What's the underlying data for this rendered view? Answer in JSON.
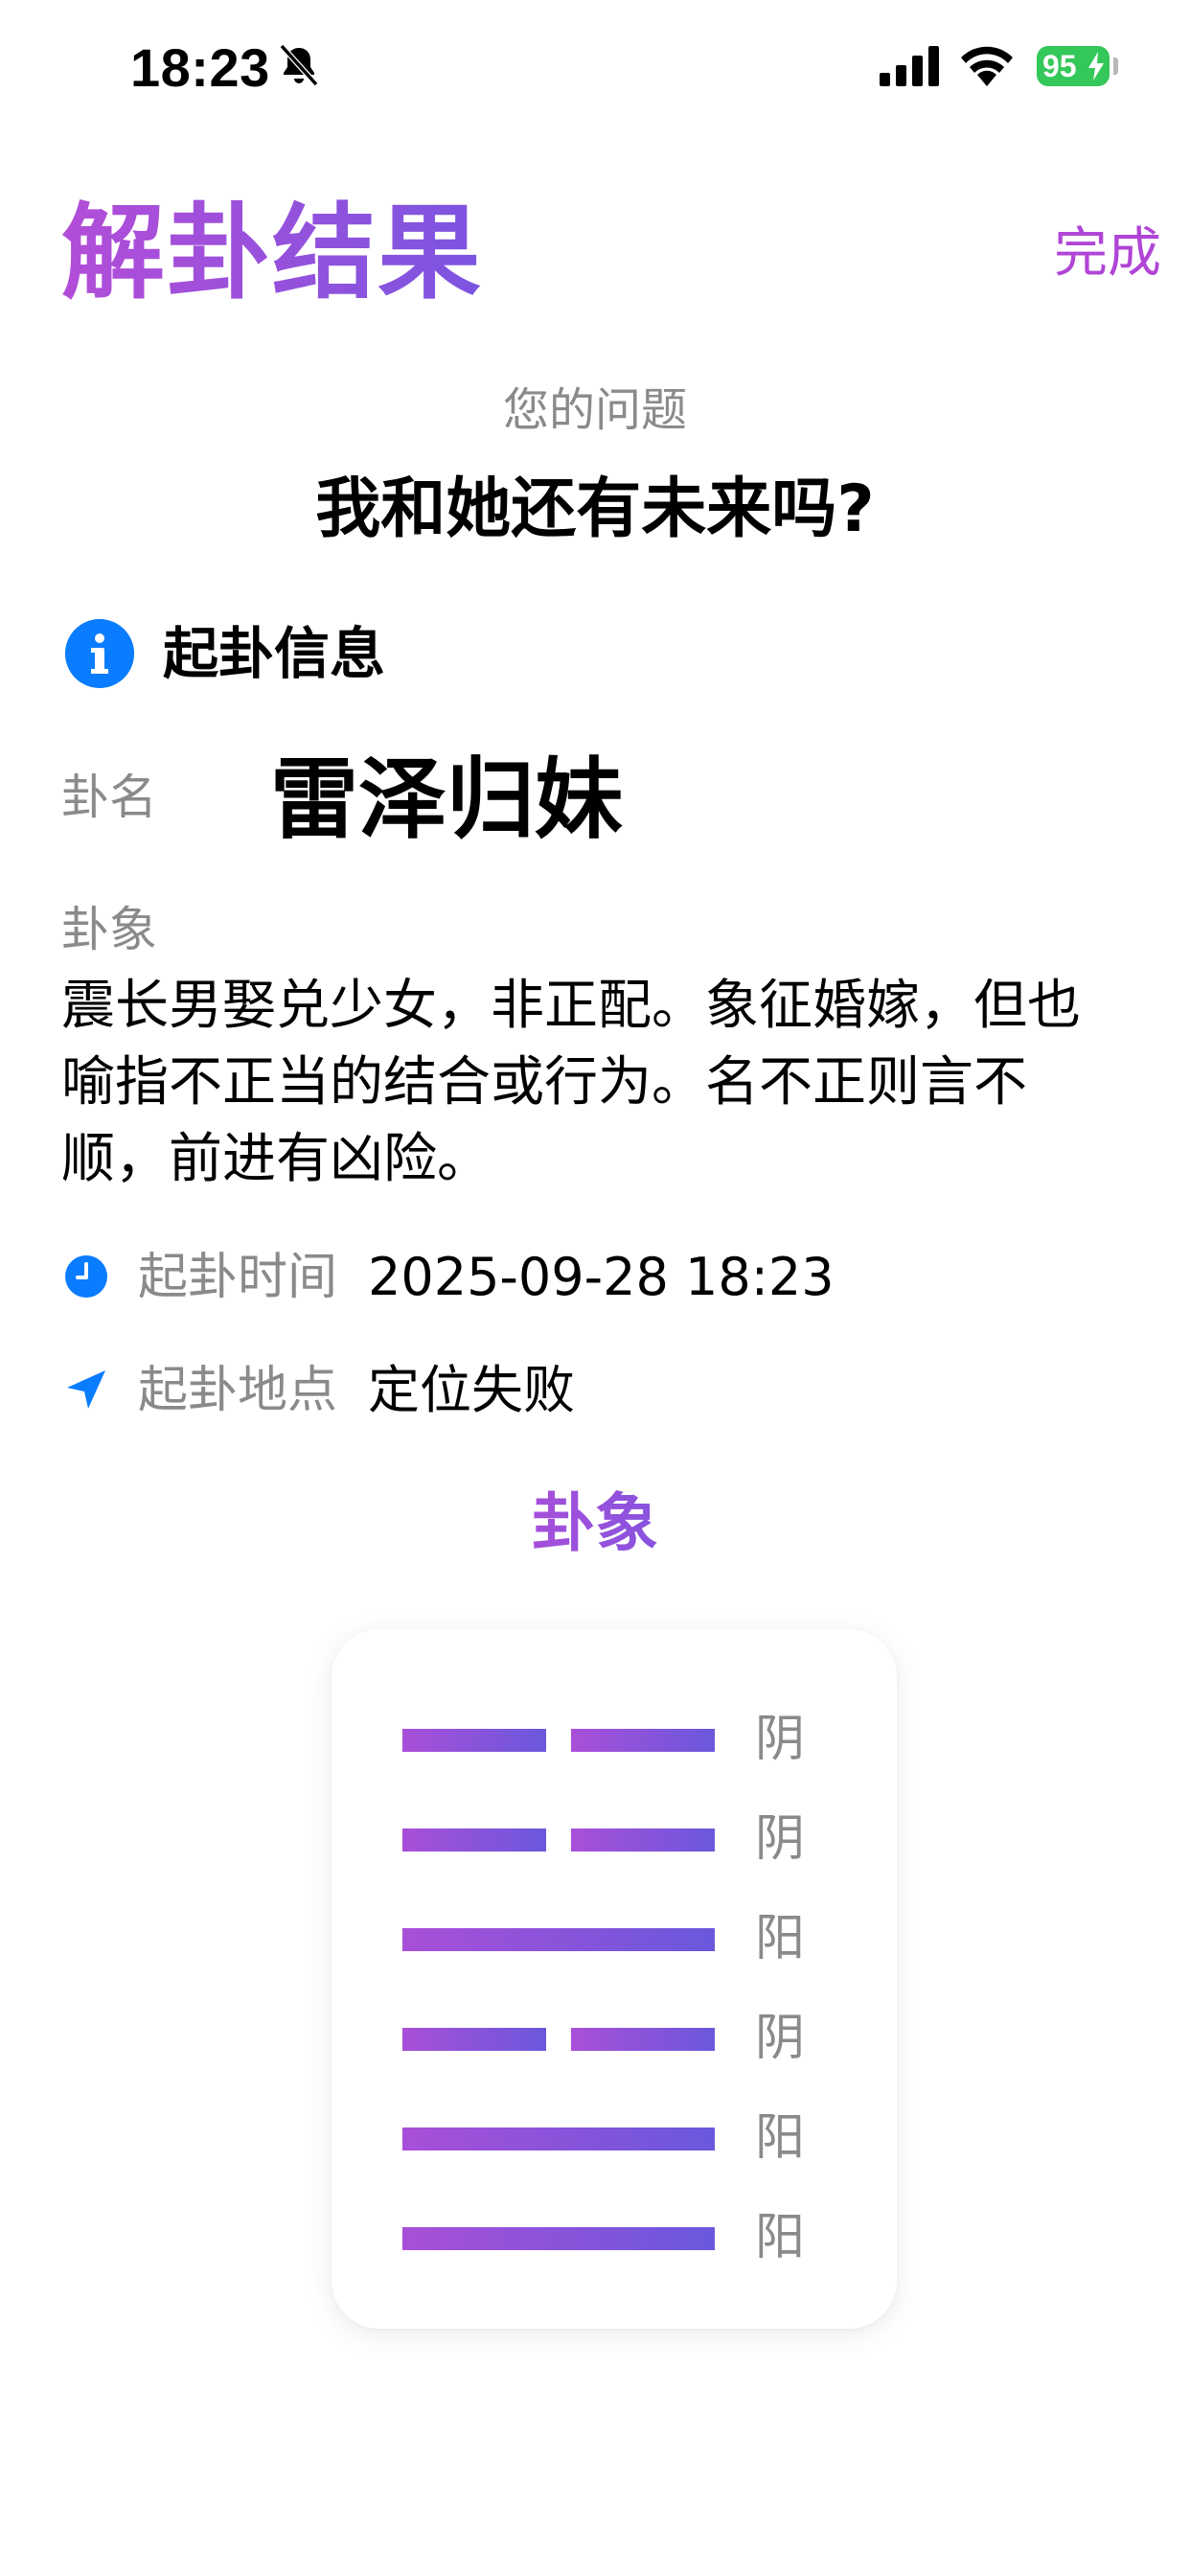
{
  "status_bar": {
    "time": "18:23",
    "battery": "95",
    "icons": [
      "bell-slash-icon",
      "signal-icon",
      "wifi-icon",
      "battery-icon"
    ]
  },
  "header": {
    "title": "解卦结果",
    "done_label": "完成"
  },
  "question": {
    "label": "您的问题",
    "text": "我和她还有未来吗?"
  },
  "info": {
    "title": "起卦信息",
    "gua_label": "卦名",
    "gua_name": "雷泽归妹",
    "xiang_label": "卦象",
    "xiang_text": "震长男娶兑少女，非正配。象征婚嫁，但也喻指不正当的结合或行为。名不正则言不顺，前进有凶险。",
    "time_label": "起卦时间",
    "time_value": "2025-09-28 18:23",
    "place_label": "起卦地点",
    "place_value": "定位失败"
  },
  "hexagram": {
    "title": "卦象",
    "lines": [
      {
        "type": "yin",
        "label": "阴"
      },
      {
        "type": "yin",
        "label": "阴"
      },
      {
        "type": "yang",
        "label": "阳"
      },
      {
        "type": "yin",
        "label": "阴"
      },
      {
        "type": "yang",
        "label": "阳"
      },
      {
        "type": "yang",
        "label": "阳"
      }
    ]
  },
  "colors": {
    "accent_purple": "#b045d6",
    "accent_blue": "#0a7cff",
    "battery_green": "#34c759",
    "muted_text": "#8a8a8a"
  }
}
